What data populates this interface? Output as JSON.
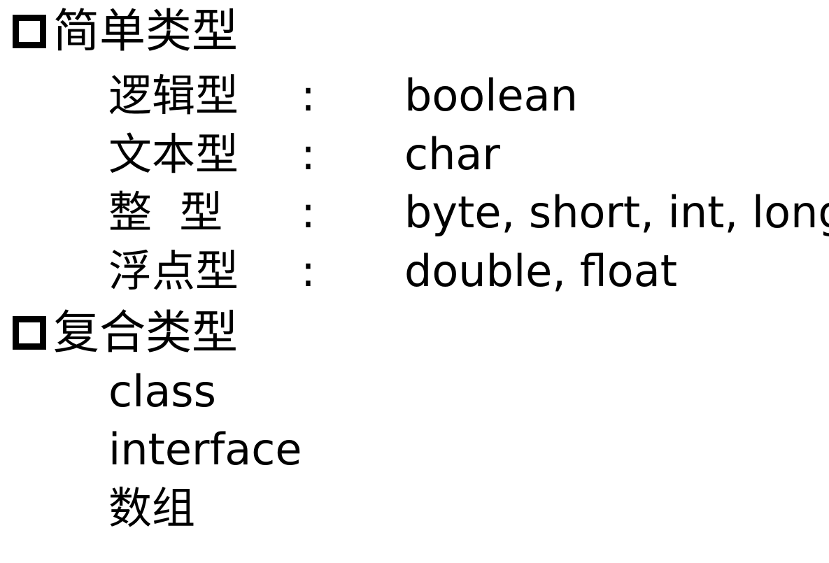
{
  "sections": [
    {
      "title": "简单类型",
      "rows": [
        {
          "name": "逻辑型",
          "sep": ":",
          "keywords": "boolean"
        },
        {
          "name": "文本型",
          "sep": ":",
          "keywords": "char"
        },
        {
          "name": "整  型",
          "sep": ":",
          "keywords": "byte, short, int, long"
        },
        {
          "name": "浮点型",
          "sep": ":",
          "keywords": "double, float"
        }
      ]
    },
    {
      "title": "复合类型",
      "items": [
        "class",
        "interface",
        "数组"
      ]
    }
  ],
  "icons": {
    "bullet": "hollow-square-bullet-icon"
  }
}
